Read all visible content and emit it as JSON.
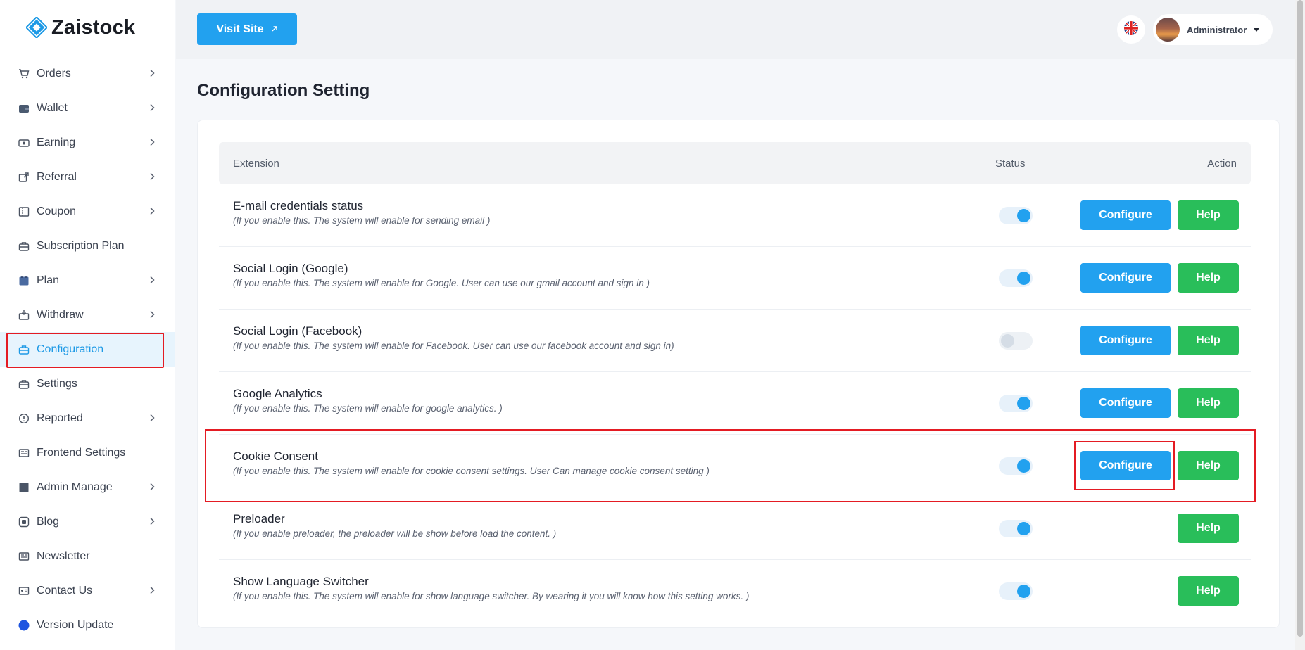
{
  "brand": {
    "name": "Zaistock"
  },
  "sidebar": {
    "items": [
      {
        "label": "Orders",
        "icon": "cart-icon",
        "chevron": true
      },
      {
        "label": "Wallet",
        "icon": "wallet-icon",
        "chevron": true
      },
      {
        "label": "Earning",
        "icon": "money-icon",
        "chevron": true
      },
      {
        "label": "Referral",
        "icon": "share-icon",
        "chevron": true
      },
      {
        "label": "Coupon",
        "icon": "ticket-icon",
        "chevron": true
      },
      {
        "label": "Subscription Plan",
        "icon": "briefcase-icon",
        "chevron": false
      },
      {
        "label": "Plan",
        "icon": "calendar-icon",
        "chevron": true
      },
      {
        "label": "Withdraw",
        "icon": "atm-icon",
        "chevron": true
      },
      {
        "label": "Configuration",
        "icon": "briefcase-icon",
        "chevron": false,
        "active": true
      },
      {
        "label": "Settings",
        "icon": "briefcase-icon",
        "chevron": false
      },
      {
        "label": "Reported",
        "icon": "alert-icon",
        "chevron": true
      },
      {
        "label": "Frontend Settings",
        "icon": "layout-icon",
        "chevron": false
      },
      {
        "label": "Admin Manage",
        "icon": "square-icon",
        "chevron": true
      },
      {
        "label": "Blog",
        "icon": "blog-icon",
        "chevron": true
      },
      {
        "label": "Newsletter",
        "icon": "layout-icon",
        "chevron": false
      },
      {
        "label": "Contact Us",
        "icon": "contact-card-icon",
        "chevron": true
      },
      {
        "label": "Version Update",
        "icon": "circle-icon",
        "chevron": false
      }
    ]
  },
  "header": {
    "visit_site_label": "Visit Site",
    "language_icon": "uk-flag-icon",
    "user_name": "Administrator"
  },
  "main": {
    "title": "Configuration Setting",
    "table": {
      "headers": {
        "extension": "Extension",
        "status": "Status",
        "action": "Action"
      },
      "rows": [
        {
          "title": "E-mail credentials status",
          "desc": "(If you enable this. The system will enable for sending email )",
          "enabled": true,
          "configure": true
        },
        {
          "title": "Social Login (Google)",
          "desc": "(If you enable this. The system will enable for Google. User can use our gmail account and sign in )",
          "enabled": true,
          "configure": true
        },
        {
          "title": "Social Login (Facebook)",
          "desc": "(If you enable this. The system will enable for Facebook. User can use our facebook account and sign in)",
          "enabled": false,
          "configure": true
        },
        {
          "title": "Google Analytics",
          "desc": "(If you enable this. The system will enable for google analytics. )",
          "enabled": true,
          "configure": true
        },
        {
          "title": "Cookie Consent",
          "desc": "(If you enable this. The system will enable for cookie consent settings. User Can manage cookie consent setting )",
          "enabled": true,
          "configure": true
        },
        {
          "title": "Preloader",
          "desc": "(If you enable preloader, the preloader will be show before load the content. )",
          "enabled": true,
          "configure": false
        },
        {
          "title": "Show Language Switcher",
          "desc": "(If you enable this. The system will enable for show language switcher. By wearing it you will know how this setting works. )",
          "enabled": true,
          "configure": false
        }
      ],
      "configure_label": "Configure",
      "help_label": "Help"
    }
  },
  "colors": {
    "primary": "#22a1ef",
    "success": "#29be5a",
    "highlight": "#e41b23"
  }
}
